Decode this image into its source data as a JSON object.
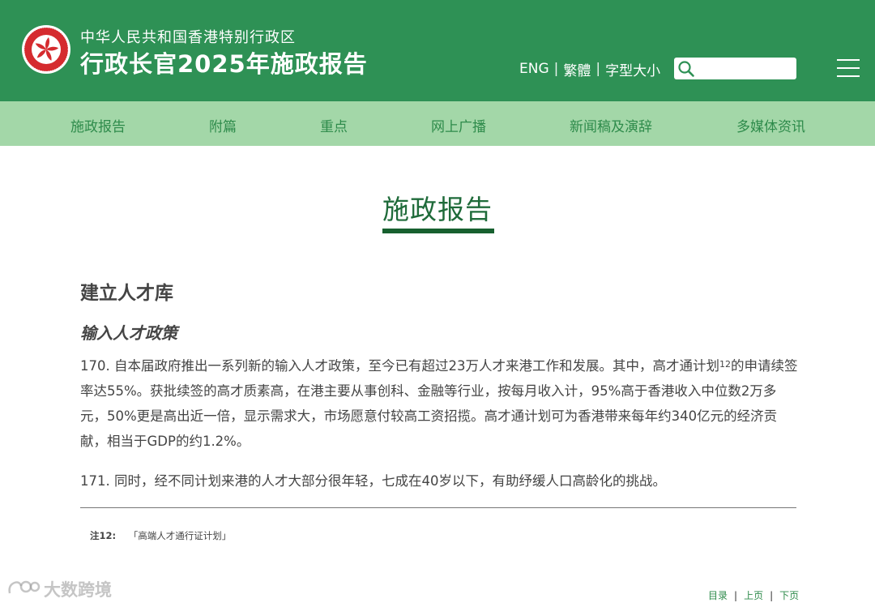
{
  "header": {
    "sub_title": "中华人民共和国香港特别行政区",
    "main_title": "行政长官2025年施政报告",
    "tools": {
      "lang_en": "ENG",
      "lang_trad": "繁體",
      "font_size": "字型大小"
    },
    "search": {
      "placeholder": "",
      "value": ""
    },
    "menu_icon": "hamburger-menu-icon",
    "emblem_icon": "hksar-emblem-icon"
  },
  "nav": {
    "items": [
      {
        "label": "施政报告"
      },
      {
        "label": "附篇"
      },
      {
        "label": "重点"
      },
      {
        "label": "网上广播"
      },
      {
        "label": "新闻稿及演辞"
      },
      {
        "label": "多媒体资讯"
      }
    ]
  },
  "main": {
    "heading": "施政报告",
    "section_title": "建立人才库",
    "subsection_title": "输入人才政策",
    "paragraphs": [
      {
        "part1": "170. 自本届政府推出一系列新的输入人才政策，至今已有超过23万人才来港工作和发展。其中，高才通计划",
        "note_ref": "12",
        "part2": "的申请续签率达55%。获批续签的高才质素高，在港主要从事创科、金融等行业，按每月收入计，95%高于香港收入中位数2万多元，50%更是高出近一倍，显示需求大，市场愿意付较高工资招揽。高才通计划可为香港带来每年约340亿元的经济贡献，相当于GDP的约1.2%。"
      },
      {
        "text": "171. 同时，经不同计划来港的人才大部分很年轻，七成在40岁以下，有助纾缓人口高龄化的挑战。"
      }
    ],
    "footnote": {
      "label": "注12:",
      "text": "「高端人才通行证计划」"
    }
  },
  "watermark": {
    "text": "大数跨境"
  },
  "pager": {
    "contents": "目录",
    "prev": "上页",
    "next": "下页",
    "sep": "|"
  },
  "colors": {
    "header_bg": "#2e9155",
    "nav_bg": "#a3d7a8",
    "nav_text": "#2e8b4b",
    "heading_text": "#1f6b3a",
    "heading_bar": "#17602f",
    "emblem_red": "#d52b2f"
  }
}
